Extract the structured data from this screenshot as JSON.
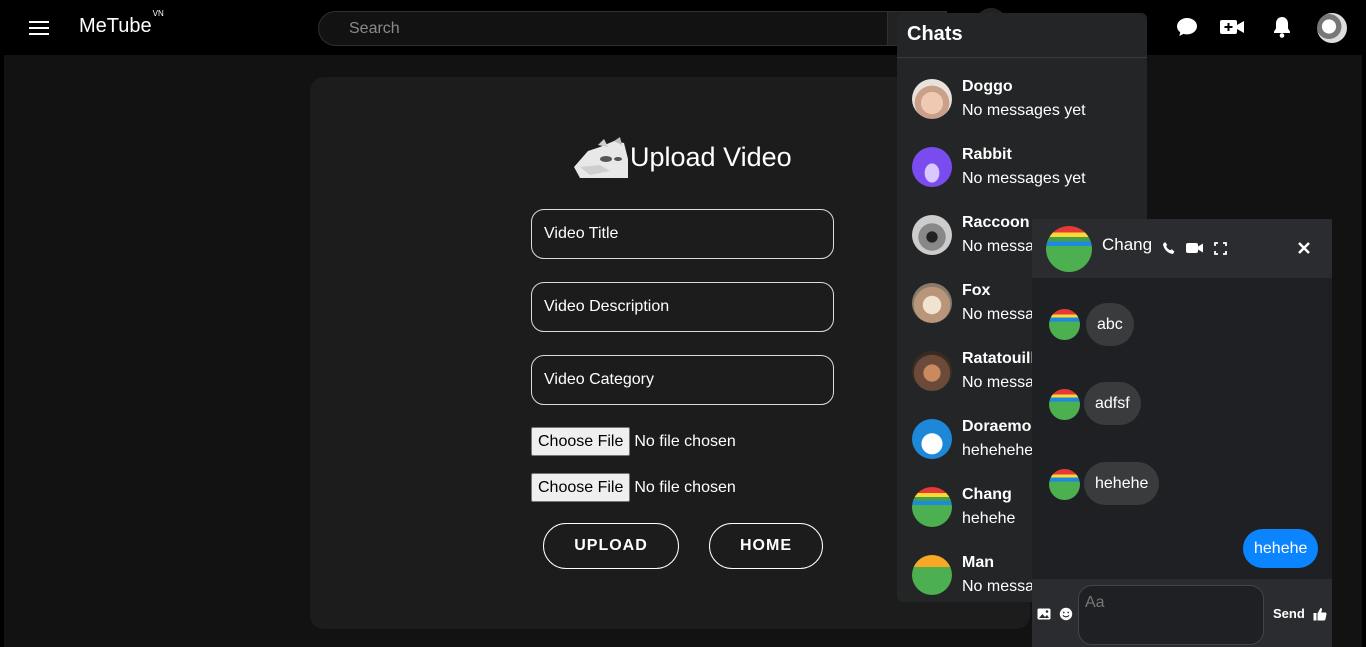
{
  "header": {
    "logo": "MeTube",
    "logo_sup": "VN",
    "search_placeholder": "Search"
  },
  "upload": {
    "title": "Upload Video",
    "title_placeholder": "Video Title",
    "description_placeholder": "Video Description",
    "category_placeholder": "Video Category",
    "choose_file_label": "Choose File",
    "no_file_text": "No file chosen",
    "upload_label": "UPLOAD",
    "home_label": "HOME"
  },
  "chats": {
    "title": "Chats",
    "items": [
      {
        "name": "Doggo",
        "preview": "No messages yet"
      },
      {
        "name": "Rabbit",
        "preview": "No messages yet"
      },
      {
        "name": "Raccoon",
        "preview": "No messages yet"
      },
      {
        "name": "Fox",
        "preview": "No messages yet"
      },
      {
        "name": "Ratatouille",
        "preview": "No messages yet"
      },
      {
        "name": "Doraemon",
        "preview": "hehehehe"
      },
      {
        "name": "Chang",
        "preview": "hehehe"
      },
      {
        "name": "Man",
        "preview": "No messages yet"
      }
    ]
  },
  "chat_window": {
    "name": "Chang",
    "messages": [
      {
        "text": "abc",
        "from": "them"
      },
      {
        "text": "adfsf",
        "from": "them"
      },
      {
        "text": "hehehe",
        "from": "them"
      },
      {
        "text": "hehehe",
        "from": "me"
      }
    ],
    "input_placeholder": "Aa",
    "send_label": "Send"
  },
  "colors": {
    "accent": "#0a84ff",
    "panel": "#242526",
    "card": "#1c1c1c"
  }
}
